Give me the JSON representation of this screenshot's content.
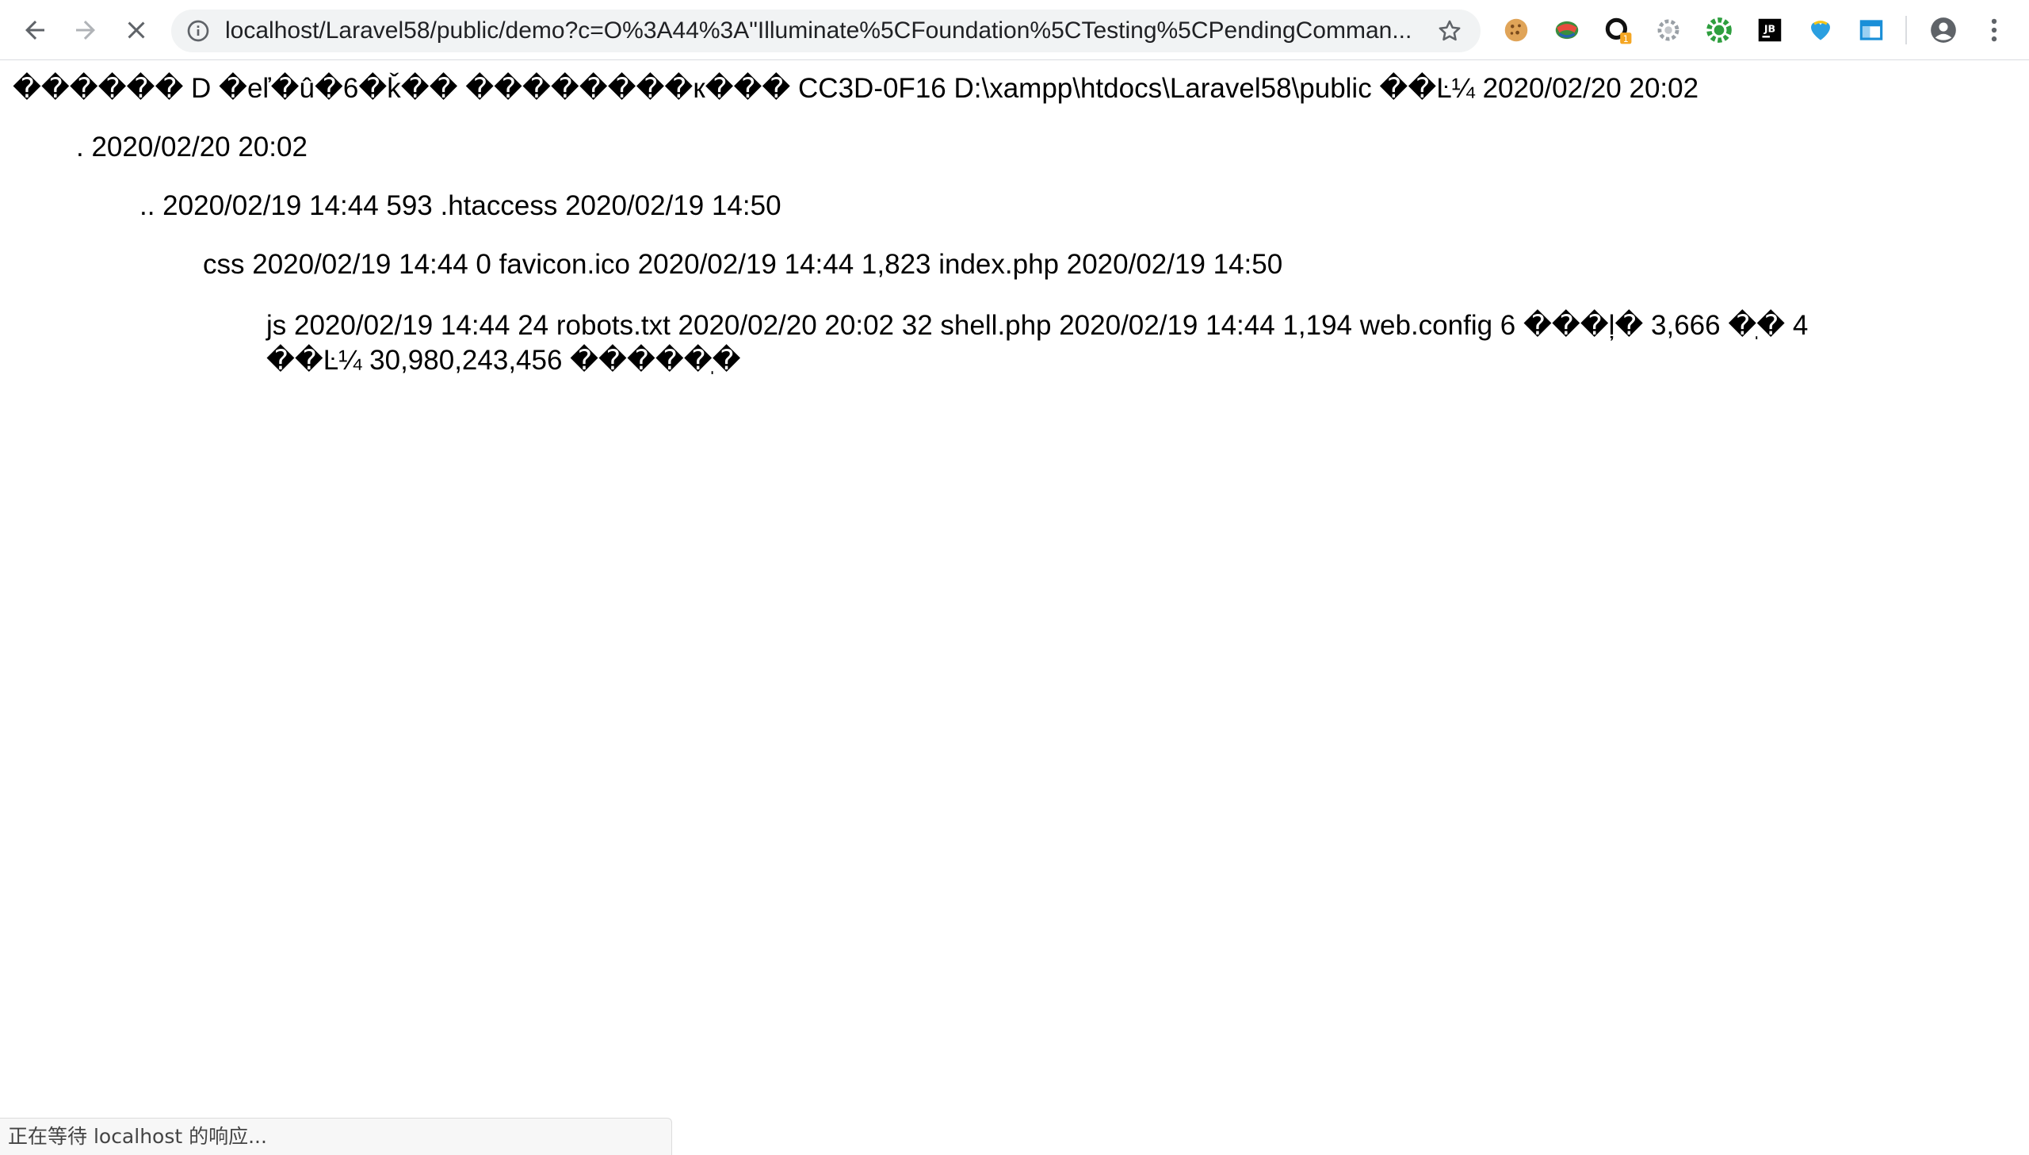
{
  "browser": {
    "address_bar": {
      "url": "localhost/Laravel58/public/demo?c=O%3A44%3A\"Illuminate%5CFoundation%5CTesting%5CPendingComman...",
      "info_icon": "info-icon",
      "bookmark_icon": "star-icon"
    },
    "nav": {
      "back_icon": "arrow-left-icon",
      "forward_icon": "arrow-right-icon",
      "stop_icon": "close-icon"
    },
    "extensions": [
      {
        "icon": "cookie-icon"
      },
      {
        "icon": "globe-icon"
      },
      {
        "icon": "ring-icon",
        "badge": "1"
      },
      {
        "icon": "gear-gray-icon"
      },
      {
        "icon": "gear-green-icon"
      },
      {
        "icon": "jb-icon",
        "label": "JB"
      },
      {
        "icon": "heart-icon"
      },
      {
        "icon": "window-icon"
      }
    ],
    "profile_icon": "account-icon",
    "menu_icon": "more-vert-icon"
  },
  "page": {
    "lines": [
      "������ D �eľ�û�6�ǩ�� ��������к��� CC3D-0F16 D:\\xampp\\htdocs\\Laravel58\\public ��Ŀ¼ 2020/02/20 20:02",
      ". 2020/02/20 20:02",
      ".. 2020/02/19 14:44 593 .htaccess 2020/02/19 14:50",
      "css 2020/02/19 14:44 0 favicon.ico 2020/02/19 14:44 1,823 index.php 2020/02/19 14:50",
      "js 2020/02/19 14:44 24 robots.txt 2020/02/20 20:02 32 shell.php 2020/02/19 14:44 1,194 web.config 6 ���ļ� 3,666 �ֽ� 4 ��Ŀ¼ 30,980,243,456 �����ֽ�"
    ]
  },
  "status": {
    "text": "正在等待 localhost 的响应..."
  },
  "colors": {
    "omnibox_bg": "#f1f3f4",
    "icon_gray": "#5f6368",
    "text": "#000000",
    "jb_bg": "#000000",
    "green_ext": "#2e9e3e",
    "badge": "#f5a623"
  }
}
